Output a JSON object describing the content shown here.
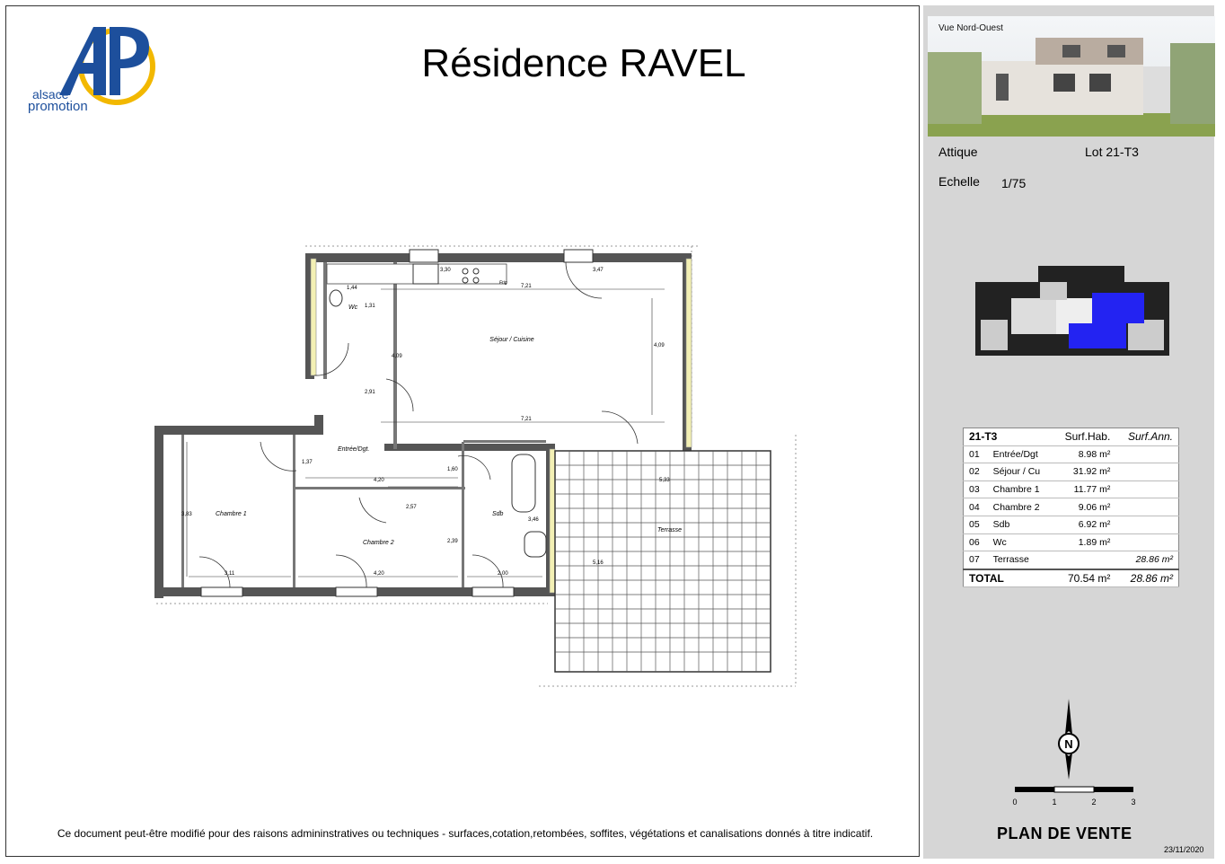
{
  "header": {
    "title": "Résidence RAVEL",
    "logo_text_line1": "alsace",
    "logo_text_line2": "promotion",
    "logo_letters": "AP"
  },
  "footer": {
    "note": "Ce document peut-être modifié pour des raisons admininstratives ou techniques - surfaces,cotation,retombées, soffites, végétations et canalisations donnés à titre indicatif."
  },
  "sidebar": {
    "photo_label": "Vue Nord-Ouest",
    "level": "Attique",
    "lot": "Lot 21-T3",
    "scale_label": "Echelle",
    "scale_value": "1/75",
    "plan_type": "PLAN DE VENTE",
    "date": "23/11/2020",
    "scale_ticks": [
      "0",
      "1",
      "2",
      "3"
    ],
    "north_label": "N"
  },
  "surfaces": {
    "header": {
      "name": "21-T3",
      "hab": "Surf.Hab.",
      "ann": "Surf.Ann."
    },
    "rows": [
      {
        "num": "01",
        "room": "Entrée/Dgt",
        "hab": "8.98 m²",
        "ann": ""
      },
      {
        "num": "02",
        "room": "Séjour / Cu",
        "hab": "31.92 m²",
        "ann": ""
      },
      {
        "num": "03",
        "room": "Chambre 1",
        "hab": "11.77 m²",
        "ann": ""
      },
      {
        "num": "04",
        "room": "Chambre 2",
        "hab": "9.06 m²",
        "ann": ""
      },
      {
        "num": "05",
        "room": "Sdb",
        "hab": "6.92 m²",
        "ann": ""
      },
      {
        "num": "06",
        "room": "Wc",
        "hab": "1.89 m²",
        "ann": ""
      },
      {
        "num": "07",
        "room": "Terrasse",
        "hab": "",
        "ann": "28.86 m²"
      }
    ],
    "total": {
      "label": "TOTAL",
      "hab": "70.54 m²",
      "ann": "28.86 m²"
    }
  },
  "plan": {
    "rooms": {
      "sejour": "Séjour / Cuisine",
      "wc": "Wc",
      "entree": "Entrée/Dgt.",
      "chambre1": "Chambre 1",
      "chambre2": "Chambre 2",
      "sdb": "Sdb",
      "terrasse": "Terrasse",
      "frigo": "Frig"
    },
    "dims": {
      "d330": "3,30",
      "d347": "3,47",
      "d144": "1,44",
      "d721a": "7,21",
      "d721b": "7,21",
      "d131": "1,31",
      "d409a": "4,09",
      "d409b": "4,09",
      "d291": "2,91",
      "d137": "1,37",
      "d420a": "4,20",
      "d160": "1,60",
      "d257": "2,57",
      "d383": "3,83",
      "d239": "2,39",
      "d346": "3,46",
      "d311": "3,11",
      "d420b": "4,20",
      "d200": "2,00",
      "d533": "5,33",
      "d516": "5,16"
    }
  }
}
